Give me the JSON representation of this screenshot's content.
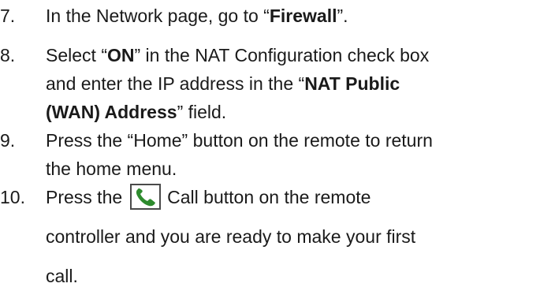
{
  "steps": [
    {
      "number": "7.",
      "pre": "In the Network page, go to “",
      "bold": "Firewall",
      "post": "”."
    },
    {
      "number": "8.",
      "line1_pre": "Select “",
      "line1_bold": "ON",
      "line1_post": "” in the NAT Configuration check box",
      "line2_pre": "and enter the IP address in the “",
      "line2_bold": "NAT Public",
      "line3_bold": "(WAN) Address",
      "line3_post": "” field."
    },
    {
      "number": "9.",
      "line1": "Press the “Home” button on the remote to return",
      "line2": "the home menu."
    },
    {
      "number": "10.",
      "line1_pre": "Press the",
      "icon": "phone-call-icon",
      "line1_post": "Call button on the remote",
      "line2": "controller and you are ready to make your first",
      "line3": "call."
    }
  ],
  "colors": {
    "text": "#1a1a1a",
    "icon": "#2e8b2e"
  }
}
